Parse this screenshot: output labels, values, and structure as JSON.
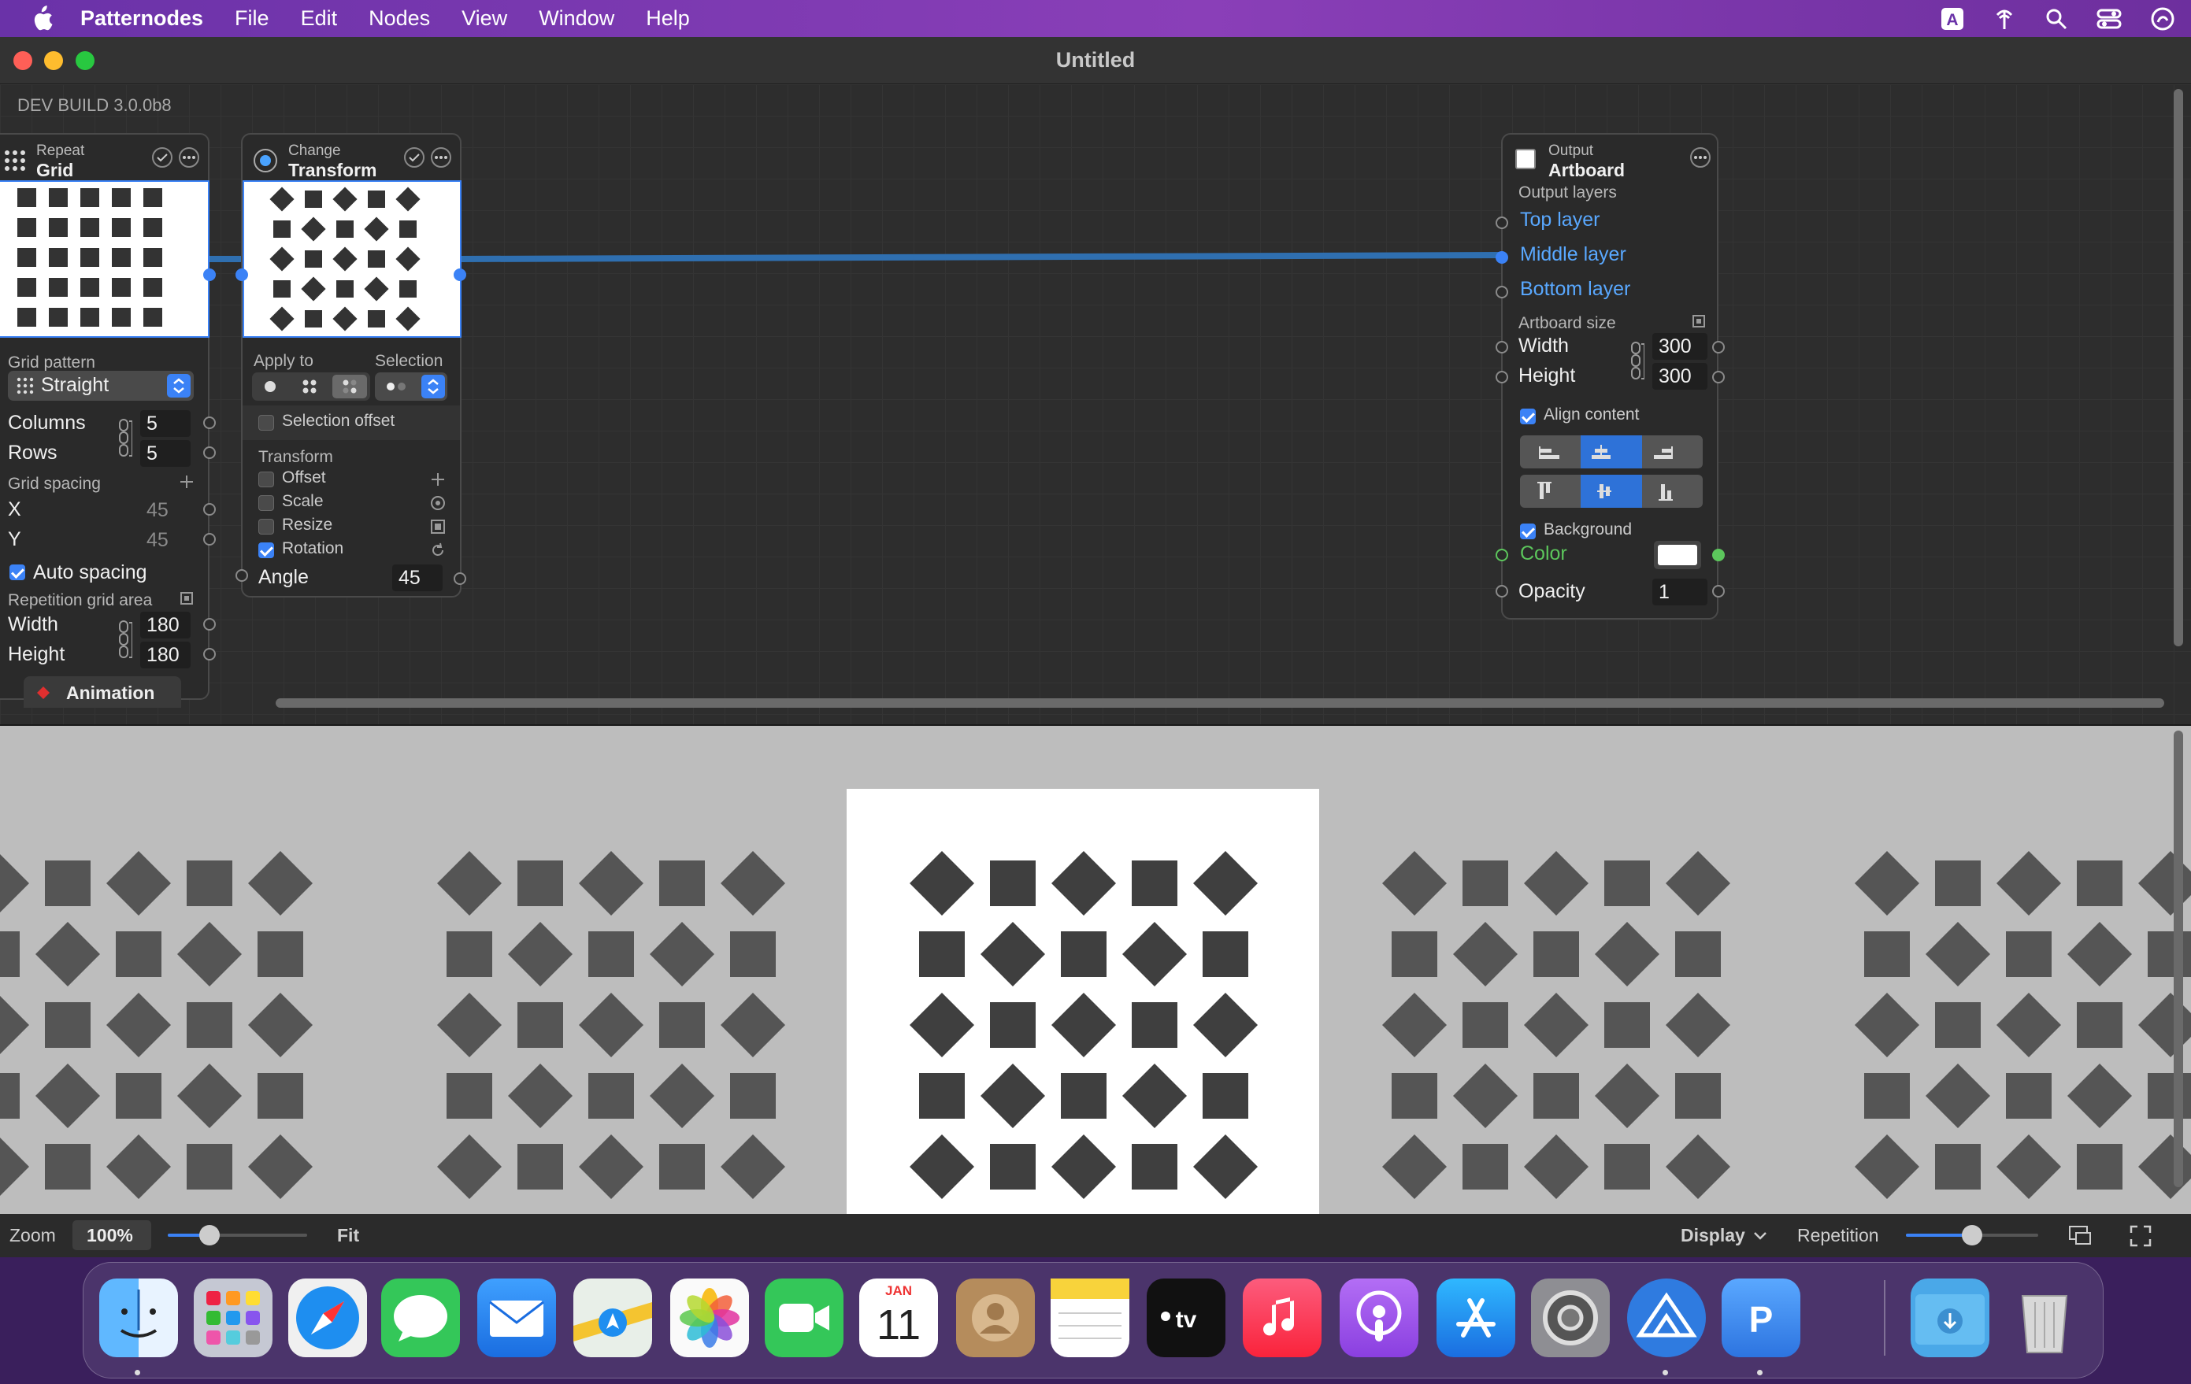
{
  "menubar": {
    "app_name": "Patternodes",
    "items": [
      "File",
      "Edit",
      "Nodes",
      "View",
      "Window",
      "Help"
    ],
    "status_icons": [
      "keyboard-a-icon",
      "antenna-icon",
      "search-icon",
      "control-center-icon",
      "siri-icon"
    ]
  },
  "window": {
    "title": "Untitled",
    "dev_build": "DEV BUILD 3.0.0b8"
  },
  "repeat_node": {
    "subtitle": "Repeat",
    "title": "Grid",
    "grid_pattern_label": "Grid pattern",
    "grid_pattern_value": "Straight",
    "columns_label": "Columns",
    "columns_value": "5",
    "rows_label": "Rows",
    "rows_value": "5",
    "grid_spacing_label": "Grid spacing",
    "x_label": "X",
    "x_value": "45",
    "y_label": "Y",
    "y_value": "45",
    "auto_spacing_label": "Auto spacing",
    "auto_spacing_checked": true,
    "repetition_area_label": "Repetition grid area",
    "width_label": "Width",
    "width_value": "180",
    "height_label": "Height",
    "height_value": "180",
    "animation_label": "Animation"
  },
  "change_node": {
    "subtitle": "Change",
    "title": "Transform",
    "apply_to_label": "Apply to",
    "selection_label": "Selection",
    "selection_offset_label": "Selection offset",
    "transform_label": "Transform",
    "offset_label": "Offset",
    "scale_label": "Scale",
    "resize_label": "Resize",
    "rotation_label": "Rotation",
    "rotation_checked": true,
    "angle_label": "Angle",
    "angle_value": "45"
  },
  "output_node": {
    "subtitle": "Output",
    "title": "Artboard",
    "output_layers_label": "Output layers",
    "layers": [
      "Top layer",
      "Middle layer",
      "Bottom layer"
    ],
    "artboard_size_label": "Artboard size",
    "width_label": "Width",
    "width_value": "300",
    "height_label": "Height",
    "height_value": "300",
    "align_content_label": "Align content",
    "align_checked": true,
    "background_label": "Background",
    "background_checked": true,
    "color_label": "Color",
    "opacity_label": "Opacity",
    "opacity_value": "1"
  },
  "statusbar": {
    "zoom_label": "Zoom",
    "zoom_value": "100%",
    "zoom_level": 0.3,
    "fit_label": "Fit",
    "display_label": "Display",
    "repetition_label": "Repetition",
    "repetition_level": 0.5
  },
  "colors": {
    "accent": "#3b82f6",
    "wire": "#2f6fb0",
    "shape": "#444444",
    "preview_bg": "#bdbdbd",
    "artboard": "#ffffff"
  },
  "dock": {
    "apps": [
      "Finder",
      "Launchpad",
      "Safari",
      "Messages",
      "Mail",
      "Maps",
      "Photos",
      "FaceTime",
      "Calendar",
      "Contacts",
      "Notes",
      "TV",
      "Music",
      "Podcasts",
      "App Store",
      "System Settings",
      "Patternodes",
      "Pages",
      "Downloads",
      "Trash"
    ],
    "calendar_month": "JAN",
    "calendar_day": "11"
  }
}
